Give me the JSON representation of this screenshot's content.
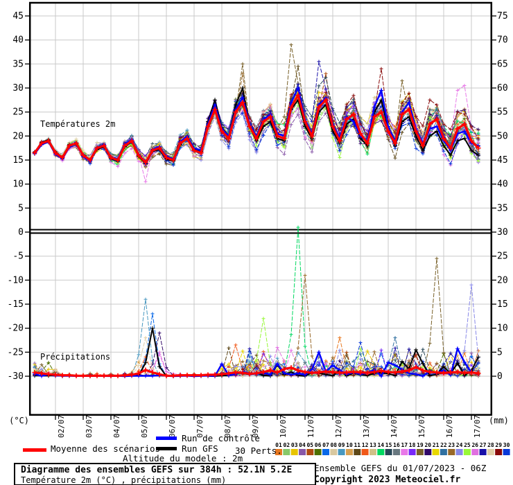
{
  "chart_data": {
    "type": "line",
    "title": "Diagramme des ensembles GEFS sur 384h : 52.1N 5.2E",
    "subtitle": "Température 2m (°C) , précipitations (mm)",
    "model_info": "Ensemble GEFS du 01/07/2023 - 06Z",
    "copyright": "Copyright 2023 Meteociel.fr",
    "altitude_note": "Altitude du modele : 2m",
    "perts_label": "30 Perts.",
    "panel_labels": {
      "temperature": "Températures 2m",
      "precipitation": "Précipitations"
    },
    "axes": {
      "left_unit": "(°C)",
      "right_unit": "(mm)",
      "left_ticks": [
        45,
        40,
        35,
        30,
        25,
        20,
        15,
        10,
        5,
        0,
        -5,
        -10,
        -15,
        -20,
        -25,
        -30
      ],
      "right_ticks": [
        75,
        70,
        65,
        60,
        55,
        50,
        45,
        40,
        35,
        30,
        25,
        20,
        15,
        10,
        5,
        0
      ],
      "x_labels": [
        "02/07",
        "03/07",
        "04/07",
        "05/07",
        "06/07",
        "07/07",
        "08/07",
        "09/07",
        "10/07",
        "11/07",
        "12/07",
        "13/07",
        "14/07",
        "15/07",
        "16/07",
        "17/07"
      ],
      "grid": true,
      "temp_zero_line_is_panel_separator": true
    },
    "step_hours": 6,
    "n_points": 65,
    "mean": {
      "label": "Moyenne des scénarios",
      "color": "#FF0000",
      "temp": [
        16.5,
        18.5,
        19.0,
        16.5,
        15.5,
        18.0,
        18.5,
        16.0,
        15.0,
        17.5,
        18.0,
        15.5,
        15.0,
        18.0,
        19.0,
        16.0,
        14.5,
        17.0,
        17.5,
        15.5,
        15.0,
        18.5,
        19.5,
        17.0,
        16.5,
        22.0,
        25.5,
        21.0,
        19.5,
        25.0,
        27.0,
        22.0,
        19.5,
        23.0,
        24.0,
        20.0,
        19.5,
        26.0,
        28.5,
        23.0,
        20.0,
        26.0,
        27.5,
        22.0,
        19.0,
        23.5,
        24.5,
        20.5,
        18.5,
        24.0,
        25.0,
        21.0,
        18.5,
        24.5,
        25.5,
        21.0,
        18.0,
        22.5,
        23.5,
        19.5,
        17.5,
        21.5,
        22.5,
        19.0,
        17.5
      ],
      "precip": [
        0.8,
        0.6,
        0.4,
        0.3,
        0.2,
        0.2,
        0.1,
        0.1,
        0.1,
        0.1,
        0.1,
        0.1,
        0.1,
        0.2,
        0.3,
        0.6,
        1.3,
        0.8,
        0.4,
        0.1,
        0.1,
        0.2,
        0.2,
        0.2,
        0.2,
        0.3,
        0.3,
        0.4,
        0.6,
        0.8,
        0.7,
        0.5,
        0.6,
        0.9,
        1.2,
        0.8,
        1.5,
        1.8,
        1.2,
        0.9,
        0.7,
        0.8,
        1.0,
        0.9,
        0.7,
        0.8,
        0.9,
        0.8,
        0.7,
        0.9,
        1.1,
        0.9,
        0.8,
        1.0,
        1.2,
        1.9,
        1.2,
        0.9,
        0.8,
        0.7,
        0.8,
        0.9,
        0.7,
        0.8,
        0.6
      ]
    },
    "control": {
      "label": "Run de contrôle",
      "color": "#0000FF",
      "precip_seed": 131,
      "temp": [
        16.3,
        18.2,
        18.8,
        16.2,
        15.3,
        17.8,
        18.6,
        15.8,
        14.8,
        17.6,
        18.2,
        15.6,
        15.2,
        18.3,
        19.3,
        16.2,
        14.3,
        17.2,
        17.8,
        15.8,
        15.2,
        18.8,
        20.0,
        17.5,
        17.0,
        22.5,
        26.5,
        21.5,
        20.0,
        25.5,
        28.0,
        22.5,
        20.0,
        23.5,
        24.5,
        20.5,
        20.0,
        27.0,
        30.0,
        23.5,
        20.5,
        26.5,
        28.0,
        22.5,
        19.5,
        24.0,
        23.0,
        20.0,
        19.0,
        26.0,
        29.5,
        22.0,
        19.0,
        25.0,
        27.0,
        21.5,
        18.5,
        21.5,
        22.0,
        19.0,
        17.0,
        20.5,
        21.0,
        18.5,
        18.0
      ]
    },
    "gfs": {
      "label": "Run GFS",
      "color": "#000000",
      "precip_seed": 137,
      "temp": [
        16.6,
        18.7,
        19.2,
        16.6,
        15.6,
        18.2,
        18.3,
        15.9,
        15.1,
        17.2,
        17.8,
        15.3,
        14.8,
        17.8,
        18.8,
        15.8,
        14.2,
        16.8,
        17.2,
        15.2,
        14.8,
        18.2,
        19.8,
        17.2,
        16.8,
        23.0,
        27.5,
        21.8,
        20.0,
        26.5,
        30.0,
        22.0,
        19.0,
        22.0,
        23.0,
        19.5,
        19.0,
        25.5,
        27.5,
        22.0,
        19.5,
        25.0,
        26.5,
        21.0,
        18.5,
        22.5,
        23.5,
        19.5,
        18.0,
        25.0,
        27.5,
        21.5,
        18.0,
        23.0,
        24.0,
        20.0,
        17.0,
        20.0,
        21.0,
        18.0,
        16.0,
        19.0,
        19.5,
        17.0,
        16.0
      ]
    },
    "spread": [
      0.5,
      0.7,
      0.8,
      0.9,
      1.0,
      1.1,
      1.2,
      1.2,
      1.3,
      1.4,
      1.5,
      1.5,
      1.6,
      1.7,
      1.8,
      1.9,
      2.0,
      2.1,
      2.2,
      2.2,
      2.3,
      2.4,
      2.5,
      2.6,
      2.7,
      2.9,
      3.1,
      3.2,
      3.3,
      3.5,
      3.7,
      3.7,
      3.8,
      3.9,
      4.0,
      4.0,
      4.1,
      4.3,
      4.5,
      4.5,
      4.5,
      4.6,
      4.7,
      4.7,
      4.8,
      4.8,
      4.9,
      4.9,
      5.0,
      5.0,
      5.1,
      5.1,
      5.2,
      5.3,
      5.4,
      5.4,
      5.5,
      5.5,
      5.6,
      5.6,
      5.7,
      5.8,
      5.9,
      5.9,
      6.0
    ],
    "members": [
      {
        "id": "01",
        "color": "#E87820",
        "seed": 107
      },
      {
        "id": "02",
        "color": "#88C868",
        "seed": 114
      },
      {
        "id": "03",
        "color": "#E8C400",
        "seed": 121
      },
      {
        "id": "04",
        "color": "#8858A8",
        "seed": 128
      },
      {
        "id": "05",
        "color": "#B04A10",
        "seed": 135
      },
      {
        "id": "06",
        "color": "#4E7000",
        "seed": 142
      },
      {
        "id": "07",
        "color": "#0868E8",
        "seed": 149
      },
      {
        "id": "08",
        "color": "#D8C8A0",
        "seed": 156
      },
      {
        "id": "09",
        "color": "#4898C0",
        "seed": 163
      },
      {
        "id": "10",
        "color": "#D8A050",
        "seed": 170
      },
      {
        "id": "11",
        "color": "#5E4818",
        "seed": 177
      },
      {
        "id": "12",
        "color": "#F05818",
        "seed": 184
      },
      {
        "id": "13",
        "color": "#D0C088",
        "seed": 191
      },
      {
        "id": "14",
        "color": "#00D860",
        "seed": 198
      },
      {
        "id": "15",
        "color": "#284858",
        "seed": 205
      },
      {
        "id": "16",
        "color": "#687880",
        "seed": 212
      },
      {
        "id": "17",
        "color": "#E878E8",
        "seed": 219
      },
      {
        "id": "18",
        "color": "#7828F8",
        "seed": 226
      },
      {
        "id": "19",
        "color": "#786028",
        "seed": 233
      },
      {
        "id": "20",
        "color": "#300868",
        "seed": 240
      },
      {
        "id": "21",
        "color": "#E8D800",
        "seed": 247
      },
      {
        "id": "22",
        "color": "#3070A0",
        "seed": 254
      },
      {
        "id": "23",
        "color": "#986828",
        "seed": 261
      },
      {
        "id": "24",
        "color": "#8888E8",
        "seed": 268
      },
      {
        "id": "25",
        "color": "#98F838",
        "seed": 275
      },
      {
        "id": "26",
        "color": "#E070E0",
        "seed": 282
      },
      {
        "id": "27",
        "color": "#1810A8",
        "seed": 289
      },
      {
        "id": "28",
        "color": "#E0D0A8",
        "seed": 296
      },
      {
        "id": "29",
        "color": "#880808",
        "seed": 303
      },
      {
        "id": "30",
        "color": "#0838D8",
        "seed": 310
      }
    ],
    "temp_overrides": [
      {
        "member": 19,
        "i": 30,
        "v": 35.0
      },
      {
        "member": 23,
        "i": 30,
        "v": 33.0
      },
      {
        "member": 19,
        "i": 36,
        "v": 24.0
      },
      {
        "member": 19,
        "i": 37,
        "v": 39.0
      },
      {
        "member": 19,
        "i": 38,
        "v": 31.0
      },
      {
        "member": 19,
        "i": 39,
        "v": 24.0
      },
      {
        "member": 11,
        "i": 38,
        "v": 34.5
      },
      {
        "member": 27,
        "i": 41,
        "v": 35.5
      },
      {
        "member": 5,
        "i": 42,
        "v": 33.0
      },
      {
        "member": 29,
        "i": 50,
        "v": 34.0
      },
      {
        "member": 19,
        "i": 53,
        "v": 31.5
      },
      {
        "member": 17,
        "i": 16,
        "v": 10.5
      },
      {
        "member": 17,
        "i": 61,
        "v": 29.5
      },
      {
        "member": 17,
        "i": 62,
        "v": 30.5
      }
    ],
    "precip_spikes": [
      {
        "member": 9,
        "i": 16,
        "peak": 16
      },
      {
        "member": 7,
        "i": 17,
        "peak": 13
      },
      {
        "member": "GFS",
        "i": 17,
        "peak": 10
      },
      {
        "member": 20,
        "i": 18,
        "peak": 9
      },
      {
        "member": 28,
        "i": 16,
        "peak": 8
      },
      {
        "member": 26,
        "i": 18,
        "peak": 5
      },
      {
        "member": 17,
        "i": 18,
        "peak": 4.5
      },
      {
        "member": 12,
        "i": 16,
        "peak": 4
      },
      {
        "member": 10,
        "i": 15,
        "peak": 3
      },
      {
        "member": 12,
        "i": 29,
        "peak": 6.5
      },
      {
        "member": 25,
        "i": 33,
        "peak": 12
      },
      {
        "member": 14,
        "i": 38,
        "peak": 31
      },
      {
        "member": 23,
        "i": 39,
        "peak": 21
      },
      {
        "member": "CTRL",
        "i": 41,
        "peak": 5
      },
      {
        "member": 1,
        "i": 44,
        "peak": 8
      },
      {
        "member": 30,
        "i": 47,
        "peak": 7
      },
      {
        "member": 22,
        "i": 52,
        "peak": 8
      },
      {
        "member": "GFS",
        "i": 55,
        "peak": 5.5
      },
      {
        "member": 19,
        "i": 58,
        "peak": 24.5
      },
      {
        "member": 24,
        "i": 63,
        "peak": 19
      },
      {
        "member": "GFS",
        "i": 64,
        "peak": 4
      }
    ],
    "grid_color": "#c9c9c9"
  }
}
